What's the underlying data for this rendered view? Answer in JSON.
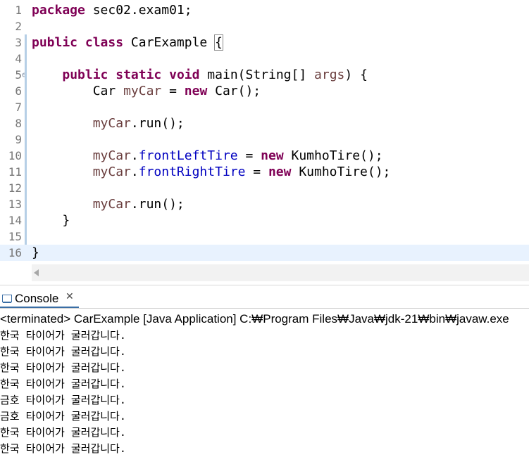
{
  "editor": {
    "line_numbers": [
      "1",
      "2",
      "3",
      "4",
      "5",
      "6",
      "7",
      "8",
      "9",
      "10",
      "11",
      "12",
      "13",
      "14",
      "15",
      "16"
    ],
    "l1": {
      "kw": "package",
      "rest": " sec02.exam01;"
    },
    "l3": {
      "kw1": "public",
      "sp1": " ",
      "kw2": "class",
      "rest": " CarExample ",
      "brace": "{"
    },
    "l5": {
      "indent": "    ",
      "kw1": "public",
      "kw2": "static",
      "kw3": "void",
      "name": " main(String[] ",
      "param": "args",
      "rest": ") {"
    },
    "l6": {
      "indent": "        ",
      "type": "Car ",
      "var": "myCar",
      "eq": " = ",
      "kw": "new",
      "rest": " Car();"
    },
    "l8": {
      "indent": "        ",
      "var": "myCar",
      "rest": ".run();"
    },
    "l10": {
      "indent": "        ",
      "var": "myCar",
      "dot": ".",
      "field": "frontLeftTire",
      "eq": " = ",
      "kw": "new",
      "rest": " KumhoTire();"
    },
    "l11": {
      "indent": "        ",
      "var": "myCar",
      "dot": ".",
      "field": "frontRightTire",
      "eq": " = ",
      "kw": "new",
      "rest": " KumhoTire();"
    },
    "l13": {
      "indent": "        ",
      "var": "myCar",
      "rest": ".run();"
    },
    "l14": {
      "indent": "    ",
      "rest": "}"
    },
    "l16": {
      "rest": "}"
    }
  },
  "console": {
    "tab_label": "Console",
    "close_glyph": "✕",
    "status": "<terminated> CarExample [Java Application] C:₩Program Files₩Java₩jdk-21₩bin₩javaw.exe",
    "output": [
      "한국 타이어가 굴러갑니다.",
      "한국 타이어가 굴러갑니다.",
      "한국 타이어가 굴러갑니다.",
      "한국 타이어가 굴러갑니다.",
      "금호 타이어가 굴러갑니다.",
      "금호 타이어가 굴러갑니다.",
      "한국 타이어가 굴러갑니다.",
      "한국 타이어가 굴러갑니다."
    ]
  },
  "colors": {
    "keyword": "#7f0055",
    "field": "#0000c0",
    "local_variable": "#6a3e3e",
    "current_line": "#e8f2fe",
    "line_number": "#787878"
  },
  "icons": {
    "console_tab": "console-icon",
    "tab_close": "close-icon",
    "fold_toggle": "collapse-toggle-icon",
    "scroll_left": "scroll-left-arrow-icon"
  }
}
